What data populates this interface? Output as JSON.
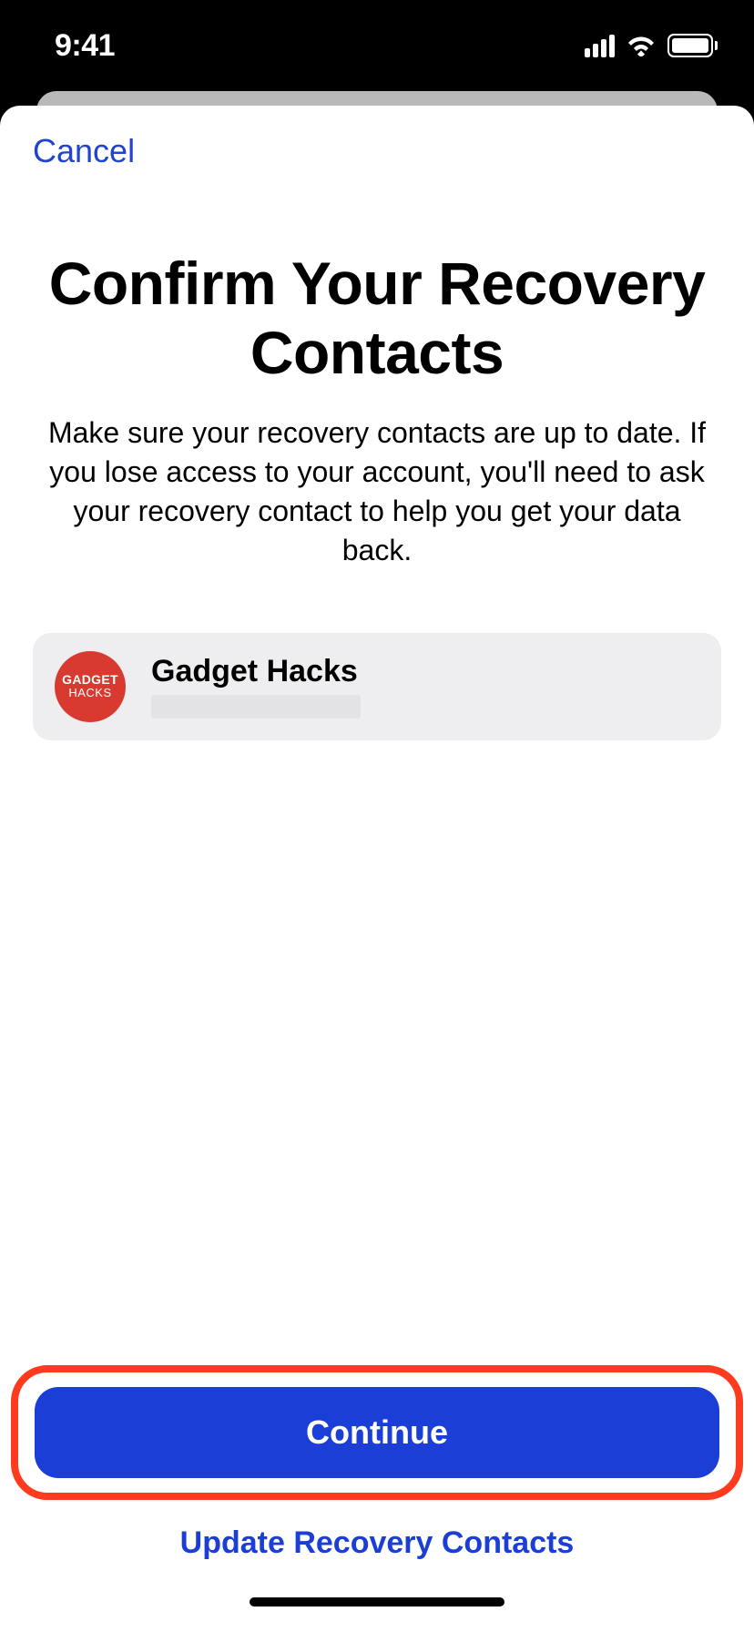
{
  "status": {
    "time": "9:41"
  },
  "nav": {
    "cancel_label": "Cancel"
  },
  "header": {
    "title": "Confirm Your Recovery Contacts",
    "description": "Make sure your recovery contacts are up to date. If you lose access to your account, you'll need to ask your recovery contact to help you get your data back."
  },
  "contacts": [
    {
      "name": "Gadget Hacks",
      "avatar_line1": "GADGET",
      "avatar_line2": "HACKS",
      "avatar_bg": "#d83a2f"
    }
  ],
  "footer": {
    "continue_label": "Continue",
    "update_label": "Update Recovery Contacts"
  }
}
